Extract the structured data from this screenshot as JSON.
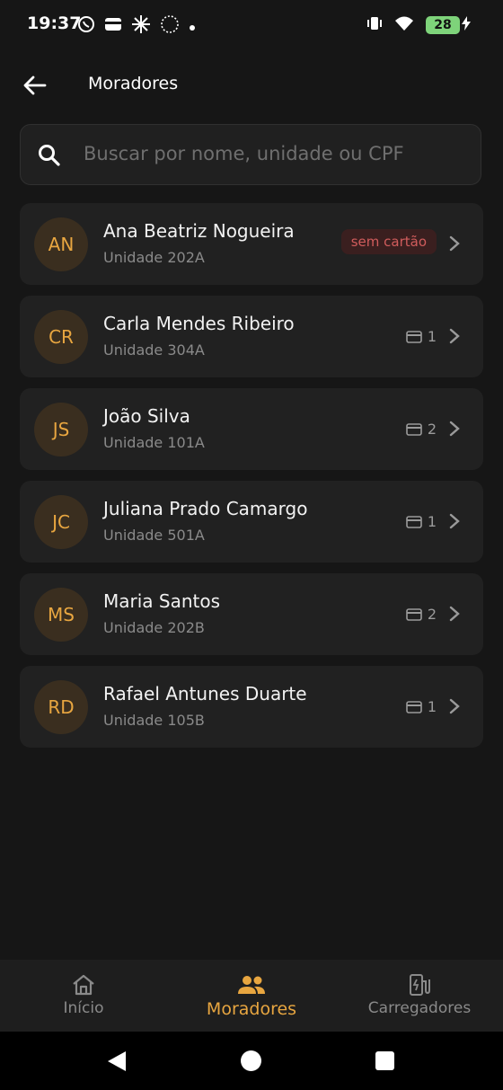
{
  "status_bar": {
    "time": "19:37",
    "icons": [
      "whatsapp-icon",
      "wallet-icon",
      "sparkle-icon",
      "circle-dots-icon",
      "dot-icon"
    ],
    "battery": "28"
  },
  "header": {
    "title": "Moradores",
    "back_icon": "arrow-left-icon"
  },
  "search": {
    "placeholder": "Buscar por nome, unidade ou CPF",
    "icon": "search-icon"
  },
  "residents": [
    {
      "initials": "AN",
      "name": "Ana Beatriz Nogueira",
      "unit": "Unidade 202A",
      "badge": "sem cartão"
    },
    {
      "initials": "CR",
      "name": "Carla Mendes Ribeiro",
      "unit": "Unidade 304A",
      "cards": "1"
    },
    {
      "initials": "JS",
      "name": "João Silva",
      "unit": "Unidade 101A",
      "cards": "2"
    },
    {
      "initials": "JC",
      "name": "Juliana Prado Camargo",
      "unit": "Unidade 501A",
      "cards": "1"
    },
    {
      "initials": "MS",
      "name": "Maria Santos",
      "unit": "Unidade 202B",
      "cards": "2"
    },
    {
      "initials": "RD",
      "name": "Rafael Antunes Duarte",
      "unit": "Unidade 105B",
      "cards": "1"
    }
  ],
  "bottom_nav": [
    {
      "label": "Início",
      "icon": "home-icon"
    },
    {
      "label": "Moradores",
      "icon": "people-icon",
      "active": true
    },
    {
      "label": "Carregadores",
      "icon": "charger-icon"
    }
  ],
  "colors": {
    "accent": "#e8a640",
    "background": "#161616",
    "card": "#212121",
    "danger": "#d05c5c"
  }
}
